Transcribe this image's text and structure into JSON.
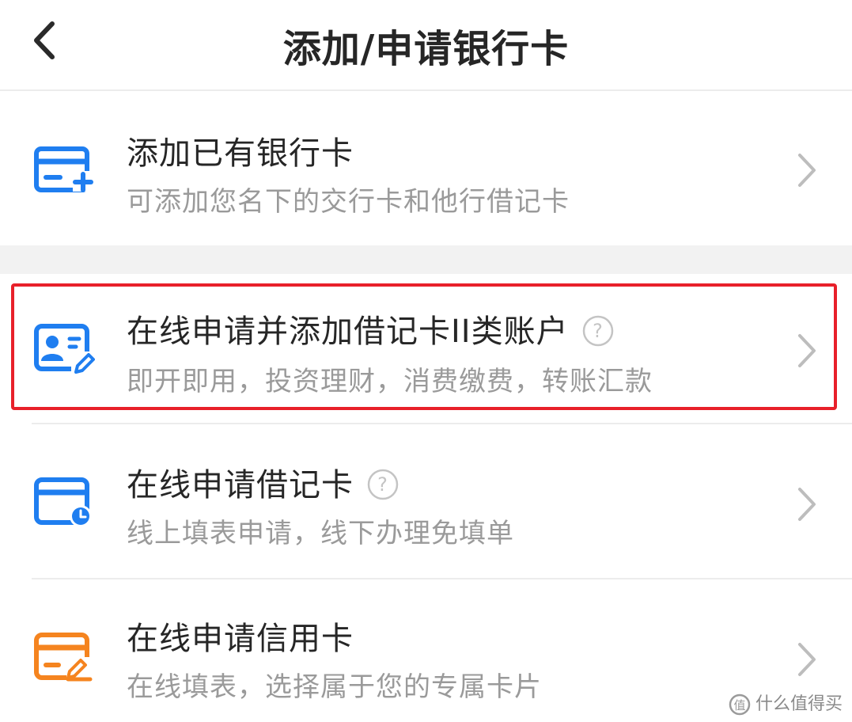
{
  "header": {
    "title": "添加/申请银行卡"
  },
  "items": [
    {
      "title": "添加已有银行卡",
      "subtitle": "可添加您名下的交行卡和他行借记卡",
      "icon": "card-add-icon"
    },
    {
      "title": "在线申请并添加借记卡II类账户",
      "subtitle": "即开即用，投资理财，消费缴费，转账汇款",
      "icon": "id-card-edit-icon",
      "has_help": true,
      "highlighted": true
    },
    {
      "title": "在线申请借记卡",
      "subtitle": "线上填表申请，线下办理免填单",
      "icon": "card-clock-icon",
      "has_help": true
    },
    {
      "title": "在线申请信用卡",
      "subtitle": "在线填表，选择属于您的专属卡片",
      "icon": "credit-card-edit-icon"
    }
  ],
  "colors": {
    "accent_blue": "#1f7ef0",
    "accent_orange": "#f5841f",
    "highlight_red": "#e8202a",
    "title_text": "#262626",
    "subtitle_text": "#9a9a9a"
  },
  "watermark": {
    "text": "什么值得买"
  }
}
